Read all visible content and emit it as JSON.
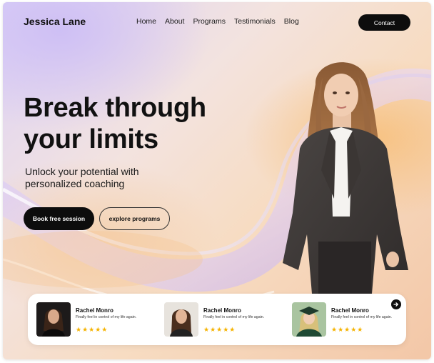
{
  "header": {
    "brand": "Jessica Lane",
    "nav": [
      "Home",
      "About",
      "Programs",
      "Testimonials",
      "Blog"
    ],
    "contact_label": "Contact"
  },
  "hero": {
    "title_line1": "Break through",
    "title_line2": "your limits",
    "subtitle_line1": "Unlock your potential with",
    "subtitle_line2": "personalized coaching",
    "primary_cta": "Book free session",
    "secondary_cta": "explore programs"
  },
  "testimonials": {
    "items": [
      {
        "name": "Rachel Monro",
        "quote": "Finally feel in control of my life again.",
        "stars": "★★★★★",
        "rating": 5
      },
      {
        "name": "Rachel Monro",
        "quote": "Finally feel in control of my life again.",
        "stars": "★★★★★",
        "rating": 5
      },
      {
        "name": "Rachel Monro",
        "quote": "Finally feel in control of my life again.",
        "stars": "★★★★★",
        "rating": 5
      }
    ],
    "next_icon": "arrow-right-icon"
  },
  "colors": {
    "primary": "#0d0d0d",
    "star": "#f5b301",
    "card_bg": "#ffffff"
  }
}
